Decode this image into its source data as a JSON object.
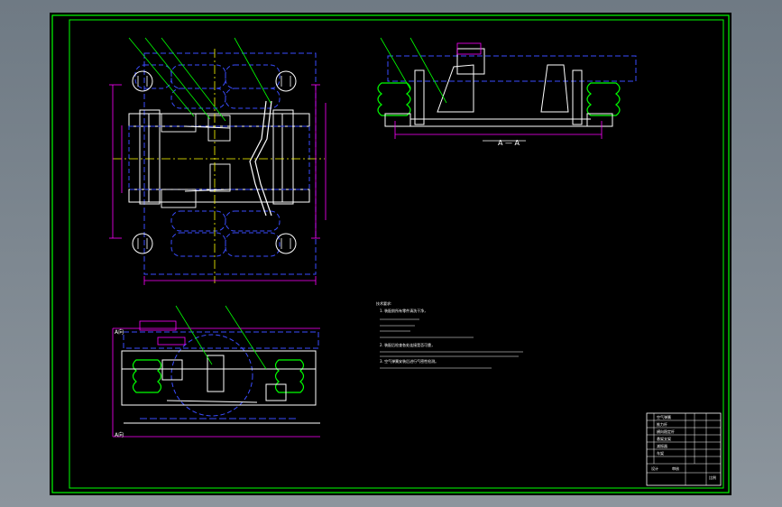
{
  "drawing": {
    "section_label": "A — A",
    "label_top": "A向",
    "label_bottom": "A向",
    "tech_requirements": {
      "heading": "技术要求:",
      "lines": [
        "1. 装配前所有零件清洗干净，",
        "2. 装配后检查各处连接是否可靠，",
        "3. 空气弹簧安装后进行气密性检测。"
      ]
    },
    "title_block": {
      "rows": [
        "空气弹簧",
        "推力杆",
        "横向稳定杆",
        "悬架支架",
        "减振器",
        "车架"
      ],
      "bottom_left": "设计",
      "bottom_mid": "审核",
      "bottom_right": "比例"
    }
  },
  "colors": {
    "sheet": "#000000",
    "border": "#00ff00",
    "part_line": "#ffffff",
    "hidden_line": "#3a4dff",
    "dimension": "#ff00ff",
    "leader": "#00ff00",
    "spring": "#00ff00",
    "frame_bg": "#7d8790"
  }
}
